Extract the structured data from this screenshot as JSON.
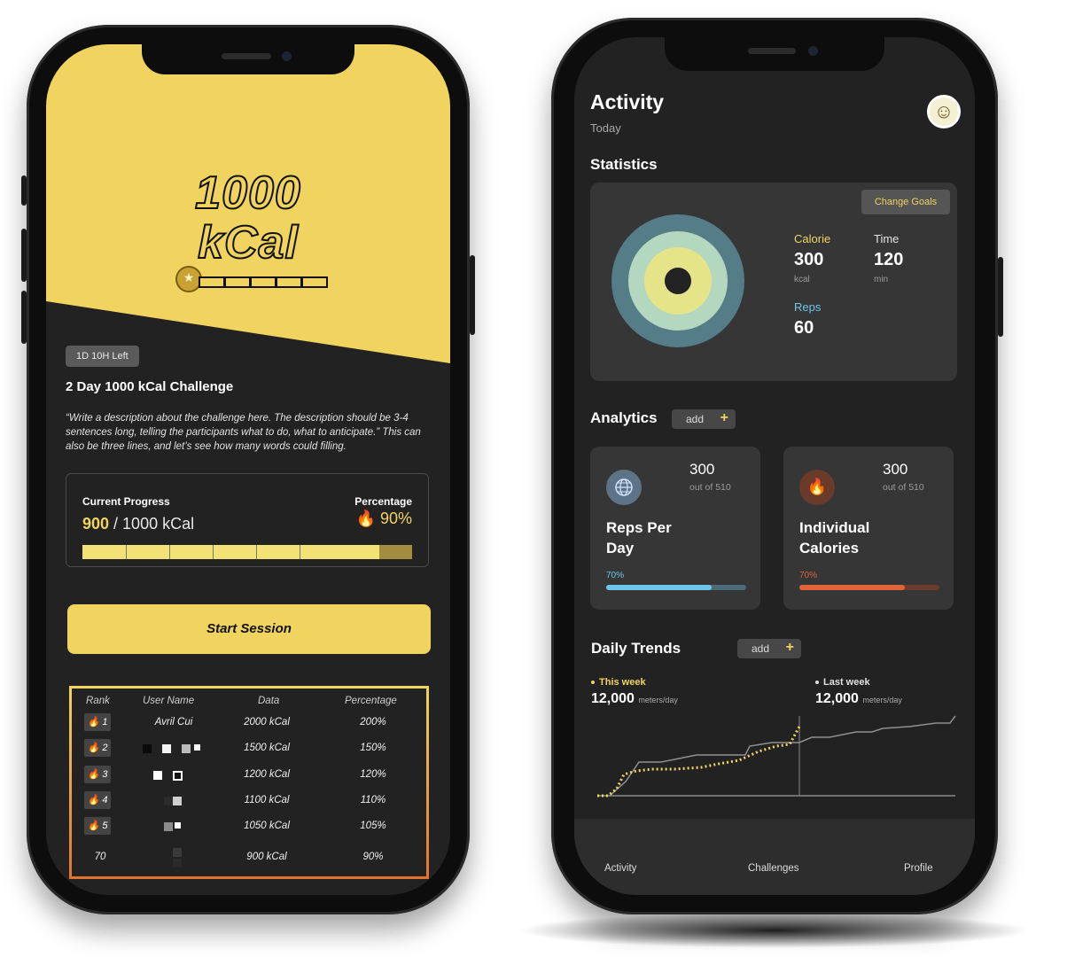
{
  "challenge_screen": {
    "hero_title_line1": "1000",
    "hero_title_line2": "kCal",
    "time_left": "1D 10H Left",
    "title": "2 Day 1000 kCal Challenge",
    "description": "“Write a description about the challenge here. The description should be 3-4 sentences long, telling the participants what to do, what to anticipate.” This can also be three lines, and let’s see how many words could filling.",
    "progress": {
      "label": "Current Progress",
      "current": "900",
      "total": " / 1000 kCal",
      "percentage_label": "Percentage",
      "percentage": "90%",
      "fraction": 0.9
    },
    "start_button": "Start Session",
    "leaderboard": {
      "headers": {
        "rank": "Rank",
        "user": "User Name",
        "data": "Data",
        "percentage": "Percentage"
      },
      "rows": [
        {
          "rank": "1",
          "user": "Avril Cui",
          "data": "2000 kCal",
          "percentage": "200%"
        },
        {
          "rank": "2",
          "user": "",
          "data": "1500 kCal",
          "percentage": "150%"
        },
        {
          "rank": "3",
          "user": "",
          "data": "1200 kCal",
          "percentage": "120%"
        },
        {
          "rank": "4",
          "user": "",
          "data": "1100 kCal",
          "percentage": "110%"
        },
        {
          "rank": "5",
          "user": "",
          "data": "1050 kCal",
          "percentage": "105%"
        },
        {
          "rank": "70",
          "user": "",
          "data": "900 kCal",
          "percentage": "90%"
        }
      ]
    }
  },
  "activity_screen": {
    "title": "Activity",
    "subtitle": "Today",
    "statistics_heading": "Statistics",
    "change_goals": "Change Goals",
    "metrics": {
      "calorie": {
        "label": "Calorie",
        "value": "300",
        "unit": "kcal"
      },
      "time": {
        "label": "Time",
        "value": "120",
        "unit": "min"
      },
      "reps": {
        "label": "Reps",
        "value": "60"
      }
    },
    "analytics_heading": "Analytics",
    "add_label": "add",
    "cards": [
      {
        "title_line1": "Reps Per",
        "title_line2": "Day",
        "value": "300",
        "sub": "out of 510",
        "pct": "70%",
        "fraction": 0.75
      },
      {
        "title_line1": "Individual",
        "title_line2": "Calories",
        "value": "300",
        "sub": "out of 510",
        "pct": "70%",
        "fraction": 0.75
      }
    ],
    "trends_heading": "Daily Trends",
    "trend_legend": {
      "this_week": {
        "label": "This week",
        "value": "12,000",
        "unit": "meters/day"
      },
      "last_week": {
        "label": "Last week",
        "value": "12,000",
        "unit": "meters/day"
      }
    },
    "nav": [
      "Activity",
      "Challenges",
      "Profile"
    ]
  },
  "colors": {
    "accent_yellow": "#f0d45f",
    "reps_blue": "#6ec6ea",
    "calorie_orange": "#e0633a",
    "ring_outer": "#557d87",
    "ring_mid": "#b3d7bf",
    "ring_inner": "#e6e488"
  },
  "icons": [
    "medal-icon",
    "fire-icon",
    "globe-icon",
    "smiley-icon"
  ]
}
